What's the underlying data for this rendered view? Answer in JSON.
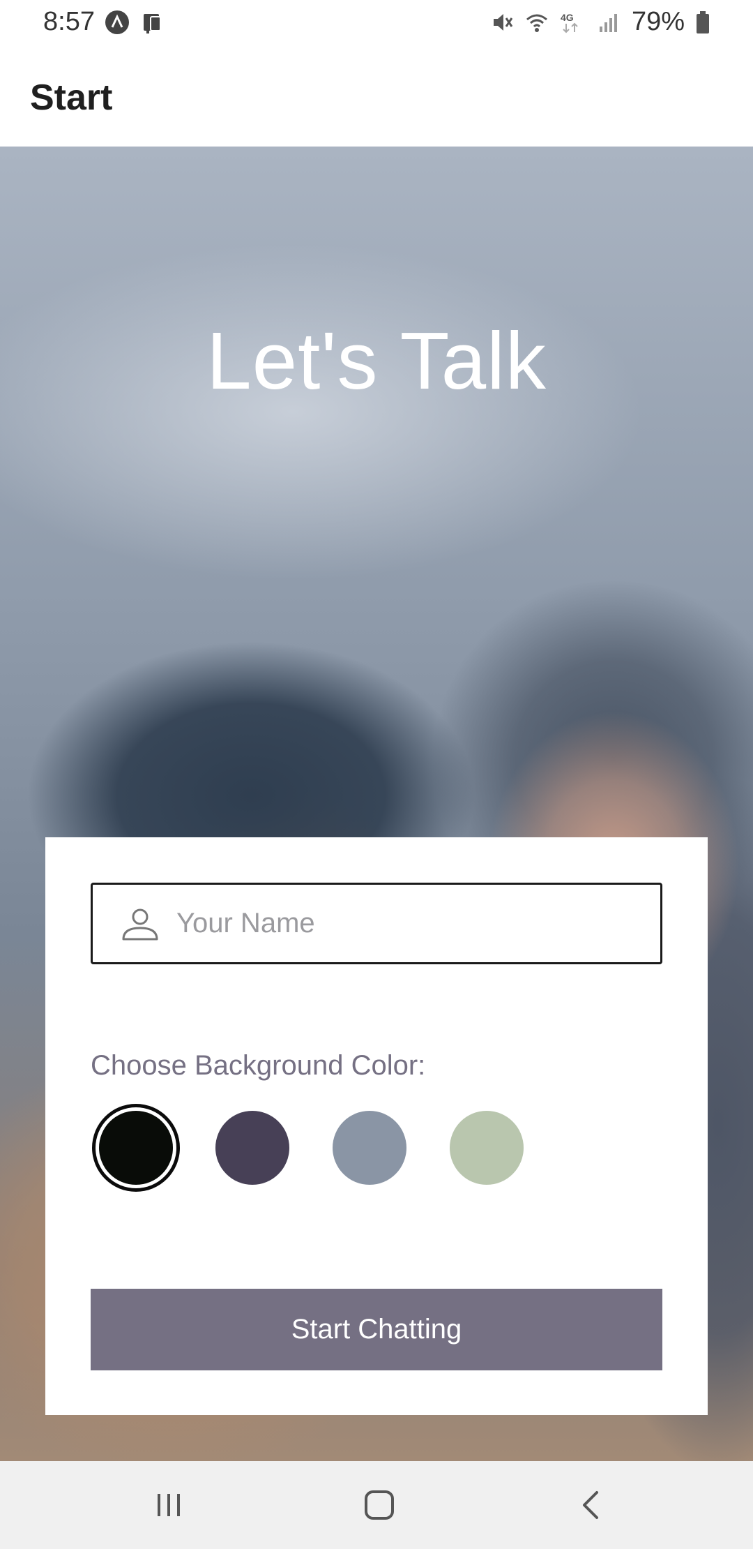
{
  "status_bar": {
    "time": "8:57",
    "battery": "79%",
    "icons": [
      "assistant-icon",
      "device-icon",
      "mute-icon",
      "wifi-icon",
      "lte-icon",
      "signal-icon",
      "battery-icon"
    ]
  },
  "header": {
    "title": "Start"
  },
  "hero": {
    "title": "Let's Talk"
  },
  "form": {
    "name_placeholder": "Your Name",
    "name_value": "",
    "color_label": "Choose Background Color:",
    "colors": [
      "#090C08",
      "#474056",
      "#8A95A5",
      "#B9C6AE"
    ],
    "selected_color": "#090C08",
    "button_label": "Start Chatting",
    "button_color": "#757083"
  },
  "nav": {
    "icons": [
      "recent-apps-icon",
      "home-icon",
      "back-icon"
    ]
  }
}
